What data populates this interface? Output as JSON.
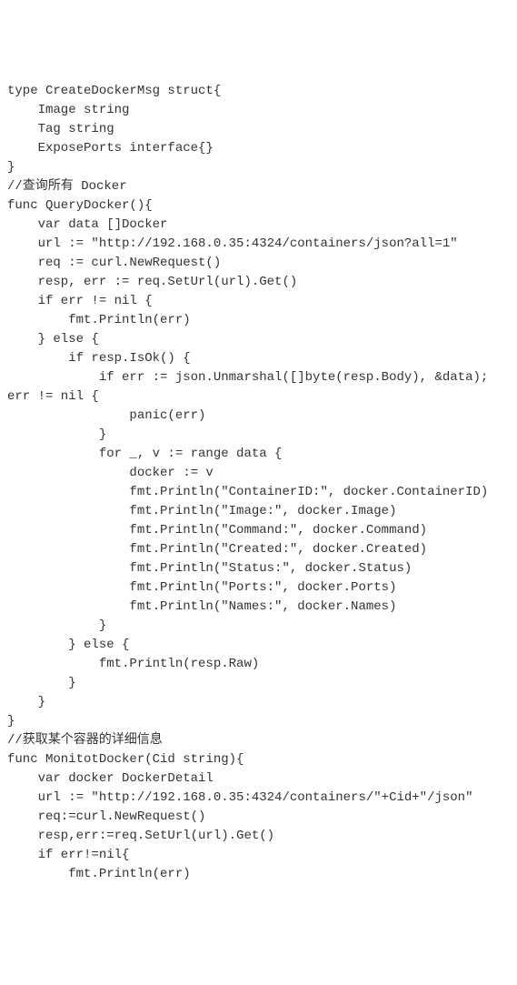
{
  "code": {
    "lines": [
      "type CreateDockerMsg struct{",
      "    Image string",
      "    Tag string",
      "    ExposePorts interface{}",
      "}",
      "//查询所有 Docker",
      "func QueryDocker(){",
      "    var data []Docker",
      "    url := \"http://192.168.0.35:4324/containers/json?all=1\"",
      "    req := curl.NewRequest()",
      "    resp, err := req.SetUrl(url).Get()",
      "    if err != nil {",
      "        fmt.Println(err)",
      "    } else {",
      "        if resp.IsOk() {",
      "            if err := json.Unmarshal([]byte(resp.Body), &data);",
      "err != nil {",
      "                panic(err)",
      "            }",
      "            for _, v := range data {",
      "                docker := v",
      "                fmt.Println(\"ContainerID:\", docker.ContainerID)",
      "                fmt.Println(\"Image:\", docker.Image)",
      "                fmt.Println(\"Command:\", docker.Command)",
      "                fmt.Println(\"Created:\", docker.Created)",
      "                fmt.Println(\"Status:\", docker.Status)",
      "                fmt.Println(\"Ports:\", docker.Ports)",
      "                fmt.Println(\"Names:\", docker.Names)",
      "            }",
      "        } else {",
      "            fmt.Println(resp.Raw)",
      "        }",
      "    }",
      "}",
      "//获取某个容器的详细信息",
      "func MonitotDocker(Cid string){",
      "    var docker DockerDetail",
      "    url := \"http://192.168.0.35:4324/containers/\"+Cid+\"/json\"",
      "    req:=curl.NewRequest()",
      "    resp,err:=req.SetUrl(url).Get()",
      "    if err!=nil{",
      "        fmt.Println(err)"
    ]
  }
}
